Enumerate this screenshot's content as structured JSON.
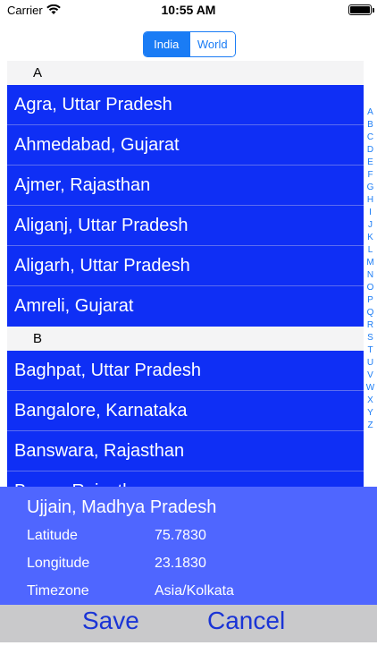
{
  "status": {
    "carrier": "Carrier",
    "time": "10:55 AM"
  },
  "segment": {
    "india": "India",
    "world": "World"
  },
  "sections": [
    {
      "header": "A",
      "rows": [
        "Agra, Uttar Pradesh",
        "Ahmedabad, Gujarat",
        "Ajmer, Rajasthan",
        "Aliganj, Uttar Pradesh",
        "Aligarh, Uttar Pradesh",
        "Amreli, Gujarat"
      ]
    },
    {
      "header": "B",
      "rows": [
        "Baghpat, Uttar Pradesh",
        "Bangalore, Karnataka",
        "Banswara, Rajasthan",
        "Baran, Rajasthan"
      ]
    }
  ],
  "index": [
    "A",
    "B",
    "C",
    "D",
    "E",
    "F",
    "G",
    "H",
    "I",
    "J",
    "K",
    "L",
    "M",
    "N",
    "O",
    "P",
    "Q",
    "R",
    "S",
    "T",
    "U",
    "V",
    "W",
    "X",
    "Y",
    "Z"
  ],
  "detail": {
    "title": "Ujjain, Madhya Pradesh",
    "latitude_label": "Latitude",
    "latitude_value": "75.7830",
    "longitude_label": "Longitude",
    "longitude_value": "23.1830",
    "timezone_label": "Timezone",
    "timezone_value": "Asia/Kolkata"
  },
  "bottom": {
    "save": "Save",
    "cancel": "Cancel"
  },
  "colors": {
    "accent": "#1a7cf5",
    "row": "#0f2ff5",
    "panel": "#4f66ff",
    "bar": "#c9c9cb"
  }
}
